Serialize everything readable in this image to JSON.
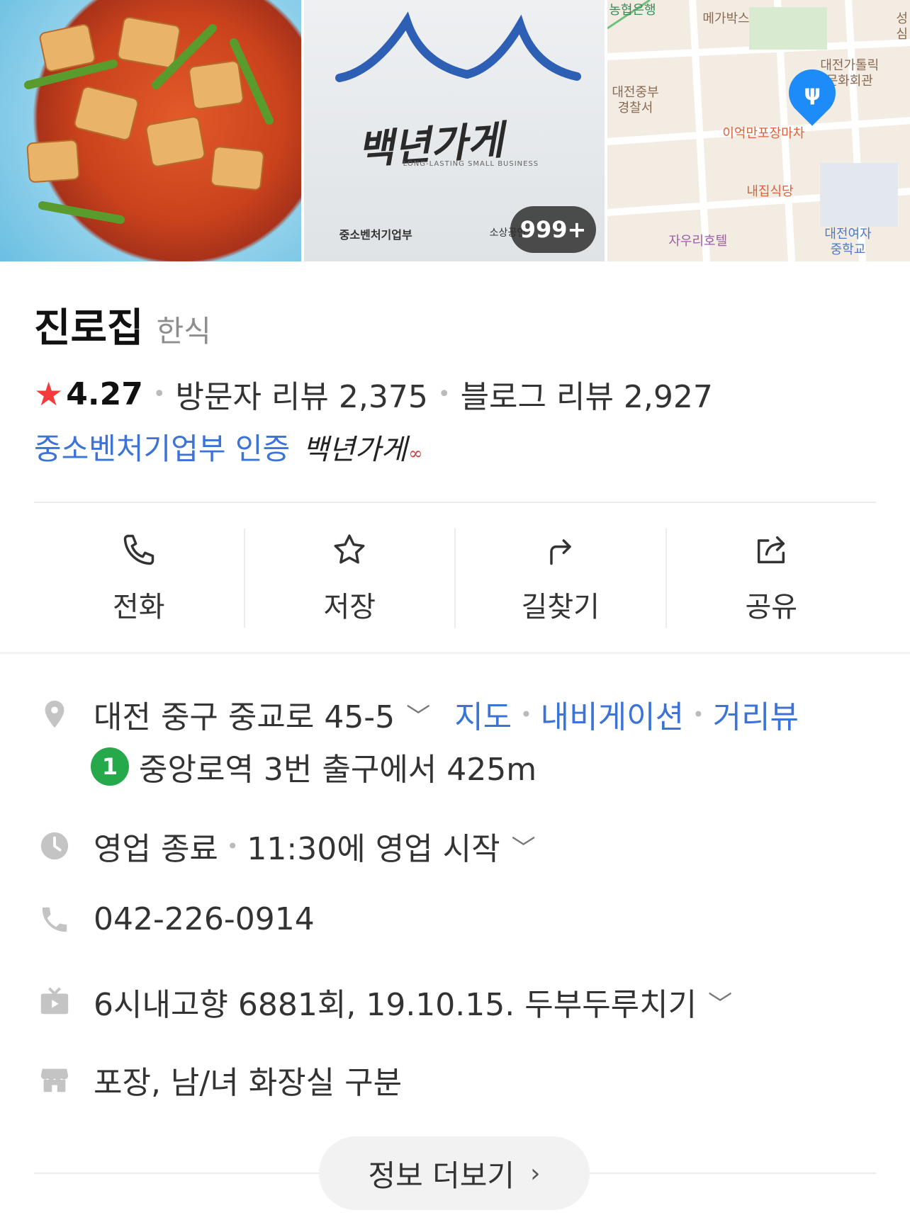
{
  "photos": {
    "more_count": "999+",
    "sign_brand": "백년가게",
    "sign_sub": "LONG-LASTING SMALL BUSINESS",
    "sign_ministry": "중소벤처기업부",
    "sign_agency": "소상공인",
    "map_labels": {
      "bank": "농협은행",
      "cinema": "메가박스",
      "cathedral": "대전가톨릭\n문화회관",
      "police": "대전중부\n경찰서",
      "stall": "이억만포장마차",
      "restaurant": "내집식당",
      "hotel": "자우리호텔",
      "school": "대전여자\n중학교",
      "edge": "성심"
    }
  },
  "place": {
    "name": "진로집",
    "category": "한식",
    "rating": "4.27",
    "visitor_reviews": "방문자 리뷰 2,375",
    "blog_reviews": "블로그 리뷰 2,927",
    "cert_text": "중소벤처기업부 인증",
    "cert_logo": "백년가게"
  },
  "actions": [
    {
      "label": "전화",
      "icon": "phone-icon"
    },
    {
      "label": "저장",
      "icon": "star-outline-icon"
    },
    {
      "label": "길찾기",
      "icon": "directions-icon"
    },
    {
      "label": "공유",
      "icon": "share-icon"
    }
  ],
  "info": {
    "address": "대전 중구 중교로 45-5",
    "map_link": "지도",
    "nav_link": "내비게이션",
    "street_link": "거리뷰",
    "subway_line": "1",
    "subway_text": "중앙로역 3번 출구에서 425m",
    "hours_status": "영업 종료",
    "hours_next": "11:30에 영업 시작",
    "phone": "042-226-0914",
    "tv": "6시내고향 6881회, 19.10.15. 두부두루치기",
    "facilities": "포장, 남/녀 화장실 구분"
  },
  "more_button": "정보 더보기",
  "colors": {
    "accent_blue": "#3c73d6",
    "star_red": "#f43a3a",
    "subway_green": "#25a94a"
  }
}
